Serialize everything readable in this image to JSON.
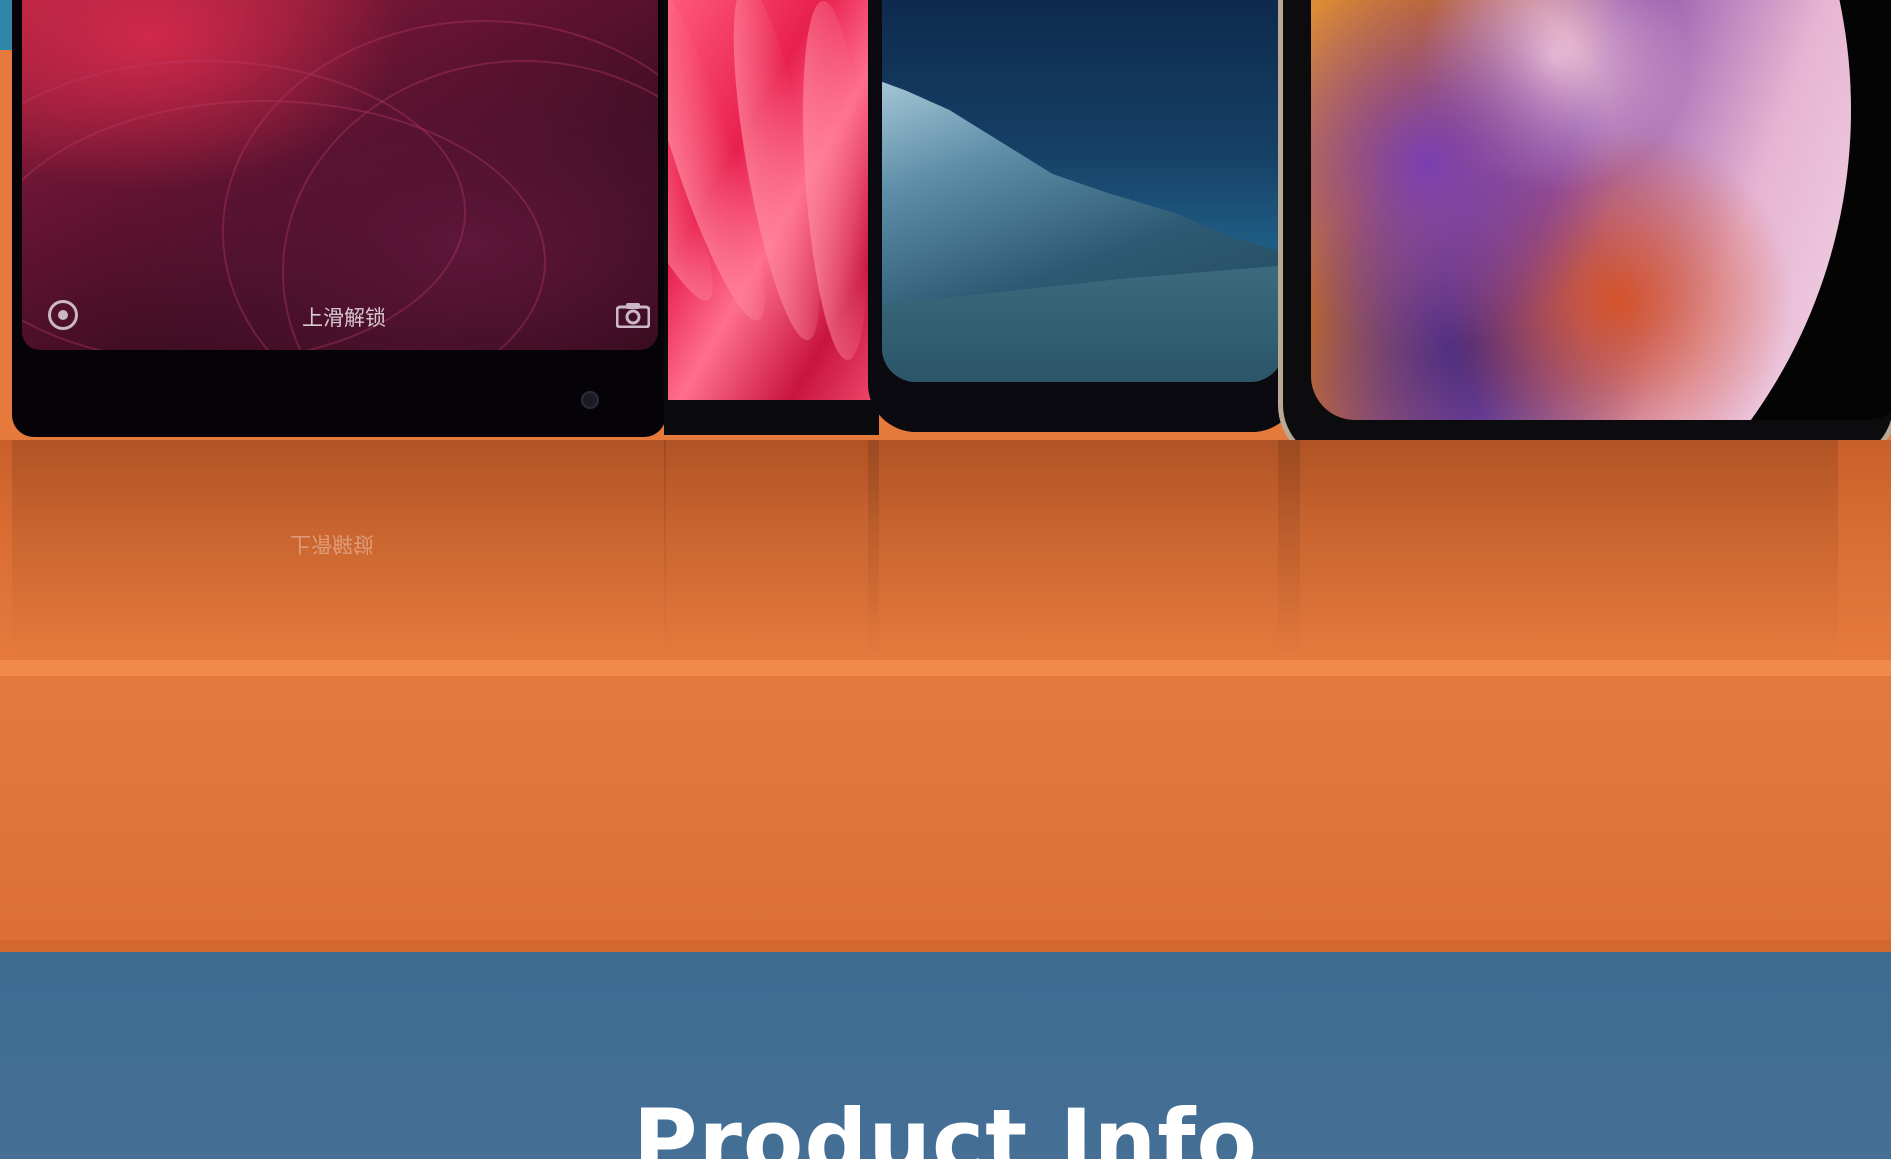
{
  "phones": {
    "mi_mix": {
      "lock_text": "上滑解锁",
      "icons": [
        "circle-icon",
        "camera-icon"
      ]
    }
  },
  "info": {
    "title": "Product Info"
  },
  "colors": {
    "orange": "#e3763a",
    "blue_band": "#3d6c93",
    "title_text": "#ffffff"
  }
}
